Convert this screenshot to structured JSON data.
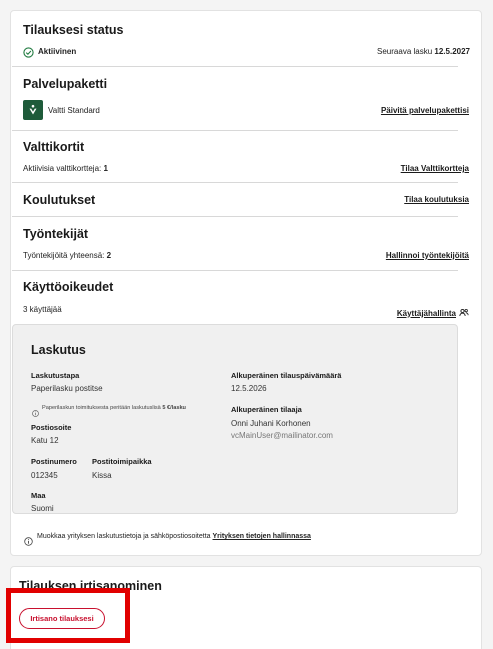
{
  "status": {
    "title": "Tilauksesi status",
    "state": "Aktiivinen",
    "next_invoice_label": "Seuraava lasku",
    "next_invoice_date": "12.5.2027"
  },
  "package": {
    "title": "Palvelupaketti",
    "name": "Valtti Standard",
    "link": "Päivitä palvelupakettisi"
  },
  "cards": {
    "title": "Valttikortit",
    "active_label": "Aktiivisia valttikortteja:",
    "active_count": "1",
    "link": "Tilaa Valttikortteja"
  },
  "trainings": {
    "title": "Koulutukset",
    "link": "Tilaa koulutuksia"
  },
  "employees": {
    "title": "Työntekijät",
    "total_label": "Työntekijöitä yhteensä:",
    "total_count": "2",
    "link": "Hallinnoi työntekijöitä"
  },
  "access": {
    "title": "Käyttöoikeudet",
    "users": "3 käyttäjää",
    "link": "Käyttäjähallinta"
  },
  "billing": {
    "title": "Laskutus",
    "method_label": "Laskutustapa",
    "method_value": "Paperilasku postitse",
    "fee_note_prefix": "Paperilaskun toimituksesta peritään laskutuslisä",
    "fee_amount": "5 €/lasku",
    "address_label": "Postiosoite",
    "address_value": "Katu 12",
    "postal_code_label": "Postinumero",
    "postal_code_value": "012345",
    "city_label": "Postitoimipaikka",
    "city_value": "Kissa",
    "country_label": "Maa",
    "country_value": "Suomi",
    "order_date_label": "Alkuperäinen tilauspäivämäärä",
    "order_date_value": "12.5.2026",
    "orderer_label": "Alkuperäinen tilaaja",
    "orderer_name": "Onni Juhani Korhonen",
    "orderer_email": "vcMainUser@mailinator.com"
  },
  "edit_note": {
    "text": "Muokkaa yrityksen laskutustietoja ja sähköpostiosoitetta",
    "link": "Yrityksen tietojen hallinnassa"
  },
  "cancellation": {
    "title": "Tilauksen irtisanominen",
    "button": "Irtisano tilauksesi"
  },
  "colors": {
    "accent_red": "#c8102e",
    "highlight_red": "#e10000",
    "logo_green": "#1e5b3a",
    "success_green": "#1f7a3f"
  }
}
